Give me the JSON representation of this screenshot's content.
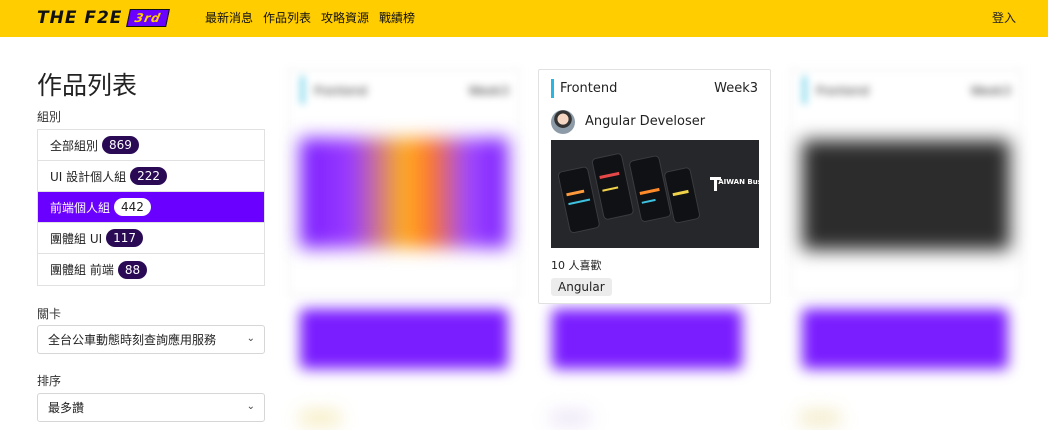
{
  "header": {
    "logo_text": "THE F2E",
    "logo_edition": "3rd",
    "nav": [
      "最新消息",
      "作品列表",
      "攻略資源",
      "戰績榜"
    ],
    "login": "登入",
    "colors": {
      "bar": "#ffcd00",
      "accent": "#6a00ff"
    }
  },
  "sidebar": {
    "title": "作品列表",
    "group_label": "組別",
    "groups": [
      {
        "label": "全部組別",
        "count": "869"
      },
      {
        "label": "UI 設計個人組",
        "count": "222"
      },
      {
        "label": "前端個人組",
        "count": "442",
        "active": true
      },
      {
        "label": "團體組 UI",
        "count": "117"
      },
      {
        "label": "團體組 前端",
        "count": "88"
      }
    ],
    "stage_label": "關卡",
    "stage_value": "全台公車動態時刻查詢應用服務",
    "sort_label": "排序",
    "sort_value": "最多讚"
  },
  "cards": {
    "blurred_left": {
      "category": "Frontend",
      "week": "Week3"
    },
    "blurred_right": {
      "category": "Frontend",
      "week": "Week3"
    },
    "focused": {
      "category": "Frontend",
      "week": "Week3",
      "author": "Angular Develoser",
      "screenshot_text": "TAIWAN Bus",
      "likes": "10 人喜歡",
      "tag": "Angular"
    }
  }
}
